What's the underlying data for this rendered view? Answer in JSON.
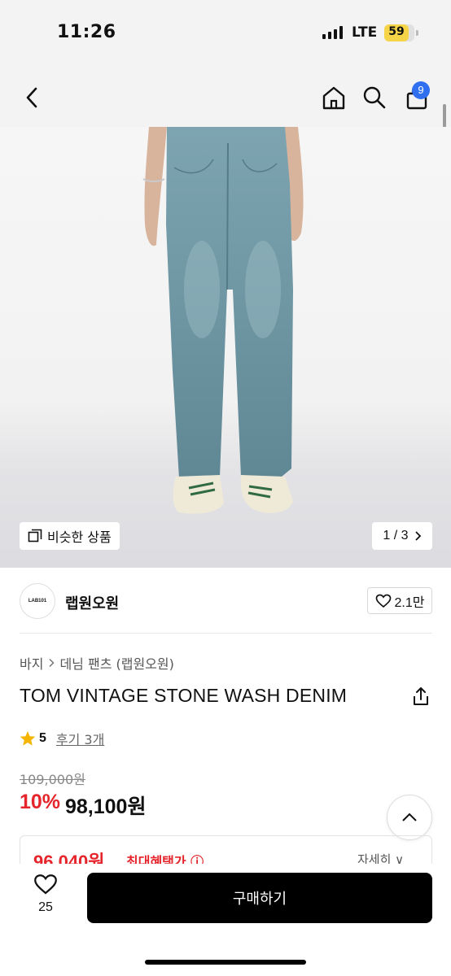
{
  "status_bar": {
    "time": "11:26",
    "network": "LTE",
    "battery": "59"
  },
  "nav": {
    "cart_count": "9",
    "icons": [
      "back-icon",
      "home-icon",
      "search-icon",
      "cart-icon"
    ]
  },
  "gallery": {
    "similar_label": "비슷한 상품",
    "counter": "1 / 3"
  },
  "brand": {
    "logo_text": "LAB101",
    "name": "랩원오원",
    "likes": "2.1만"
  },
  "breadcrumb": {
    "category": "바지",
    "subcategory": "데님 팬츠 (랩원오원)"
  },
  "product": {
    "title": "TOM VINTAGE STONE WASH DENIM",
    "rating": "5",
    "review_label": "후기 3개",
    "original_price": "109,000원",
    "discount": "10%",
    "price": "98,100원"
  },
  "benefit": {
    "price": "96,040원",
    "label": "최대혜택가 ⓘ",
    "more": "자세히 ∨"
  },
  "bottom_bar": {
    "like_count": "25",
    "buy_label": "구매하기"
  },
  "colors": {
    "accent_red": "#e5242b",
    "badge_blue": "#2f6ff0",
    "buy_button": "#000000"
  }
}
